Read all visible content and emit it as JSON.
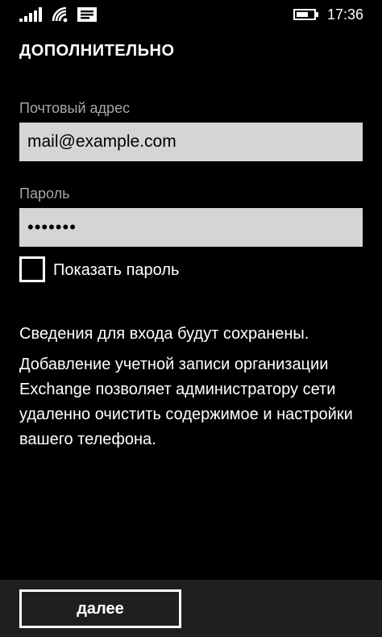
{
  "status_bar": {
    "time": "17:36",
    "icons": [
      "signal-icon",
      "wifi-icon",
      "message-icon",
      "battery-icon"
    ]
  },
  "page": {
    "title": "ДОПОЛНИТЕЛЬНО"
  },
  "form": {
    "email_label": "Почтовый адрес",
    "email_value": "mail@example.com",
    "password_label": "Пароль",
    "password_value": "•••••••",
    "show_password_label": "Показать пароль",
    "show_password_checked": false
  },
  "info": {
    "line1": "Сведения для входа будут сохранены.",
    "line2": "Добавление учетной записи организации Exchange позволяет администратору сети удаленно очистить содержимое и настройки вашего телефона."
  },
  "app_bar": {
    "next_label": "далее"
  },
  "colors": {
    "background": "#000000",
    "field_background": "#d5d5d5",
    "label_gray": "#a6a6a6",
    "app_bar": "#1f1f1f"
  }
}
